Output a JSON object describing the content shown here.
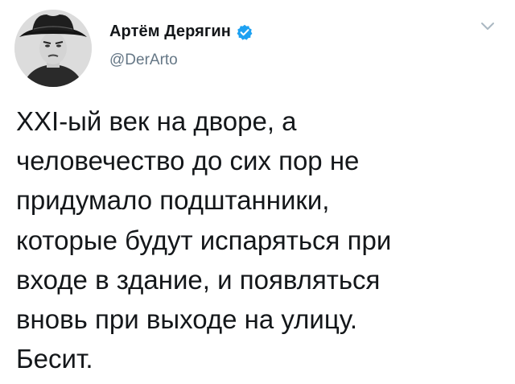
{
  "author": {
    "display_name": "Артём Дерягин",
    "handle": "@DerArto",
    "verified": true
  },
  "icons": {
    "verified": "verified-badge-icon",
    "menu": "chevron-down-icon",
    "avatar": "profile-photo"
  },
  "colors": {
    "verified_badge": "#1da1f2",
    "handle_text": "#657786",
    "body_text": "#14171a",
    "chevron": "#aab8c2"
  },
  "tweet": {
    "lines": [
      "XXI-ый век на дворе, а",
      "человечество до сих пор не",
      "придумало подштанники,",
      "которые будут испаряться при",
      "входе в здание, и появляться",
      "вновь при выходе на улицу.",
      "Бесит."
    ]
  }
}
